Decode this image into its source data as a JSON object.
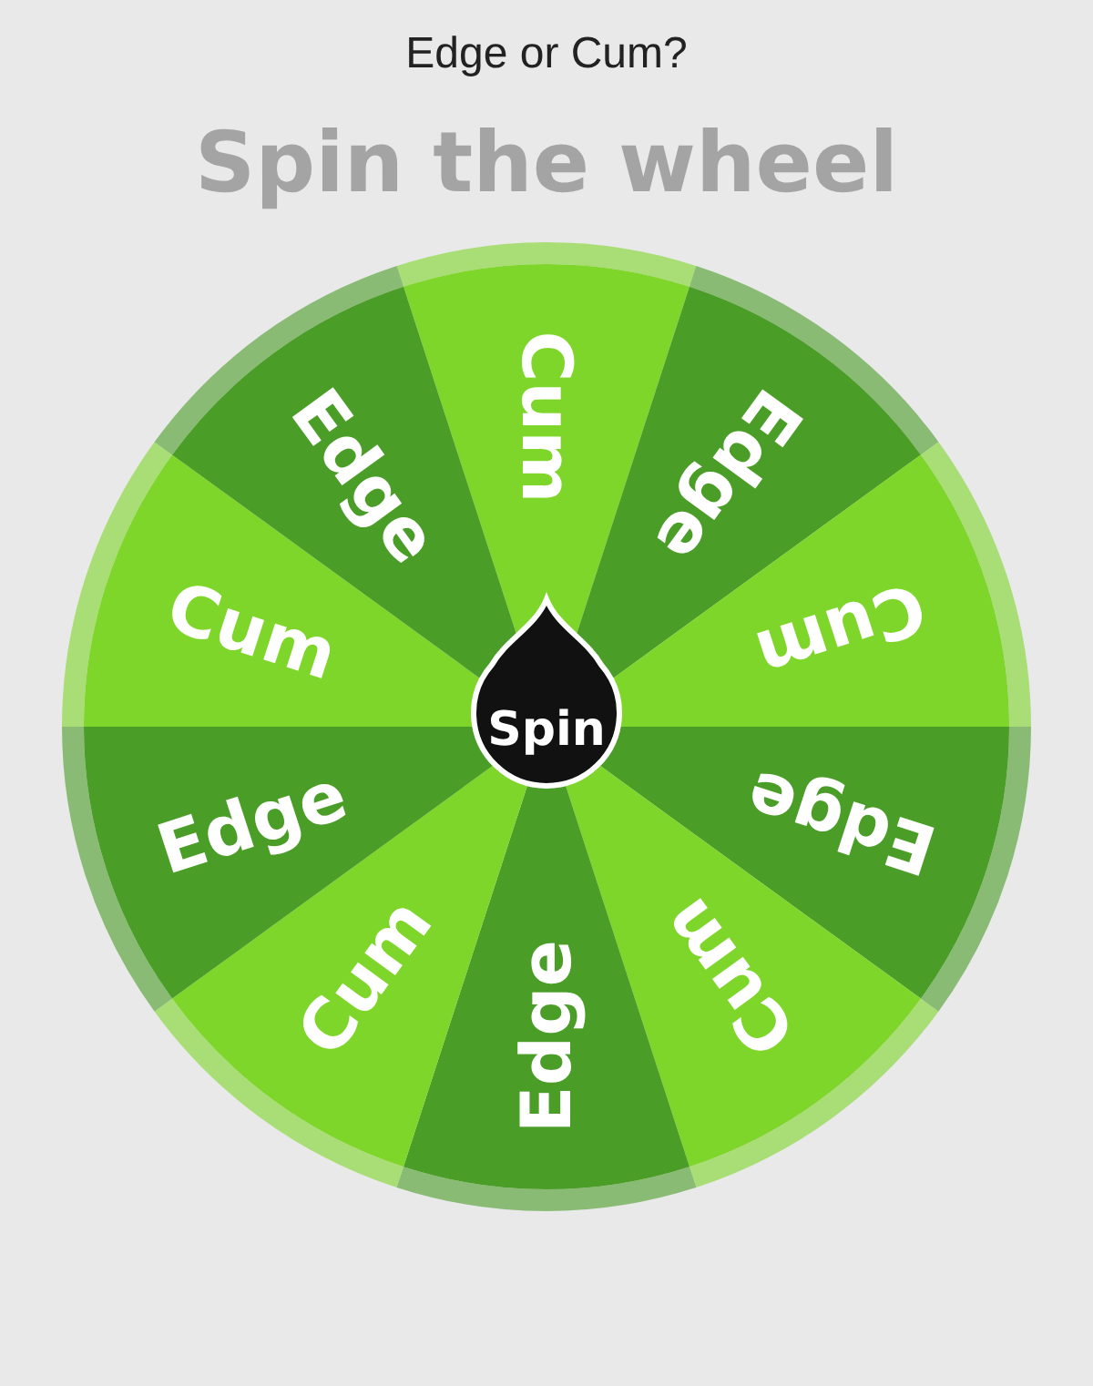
{
  "title": "Edge or Cum?",
  "heading": "Spin the wheel",
  "wheel": {
    "segments": [
      {
        "label": "Cum",
        "color": "#7fd62a"
      },
      {
        "label": "Edge",
        "color": "#4a9d26"
      },
      {
        "label": "Cum",
        "color": "#7fd62a"
      },
      {
        "label": "Edge",
        "color": "#4a9d26"
      },
      {
        "label": "Cum",
        "color": "#7fd62a"
      },
      {
        "label": "Edge",
        "color": "#4a9d26"
      },
      {
        "label": "Cum",
        "color": "#7fd62a"
      },
      {
        "label": "Edge",
        "color": "#4a9d26"
      },
      {
        "label": "Cum",
        "color": "#7fd62a"
      },
      {
        "label": "Edge",
        "color": "#4a9d26"
      }
    ],
    "spin_button": "Spin"
  }
}
